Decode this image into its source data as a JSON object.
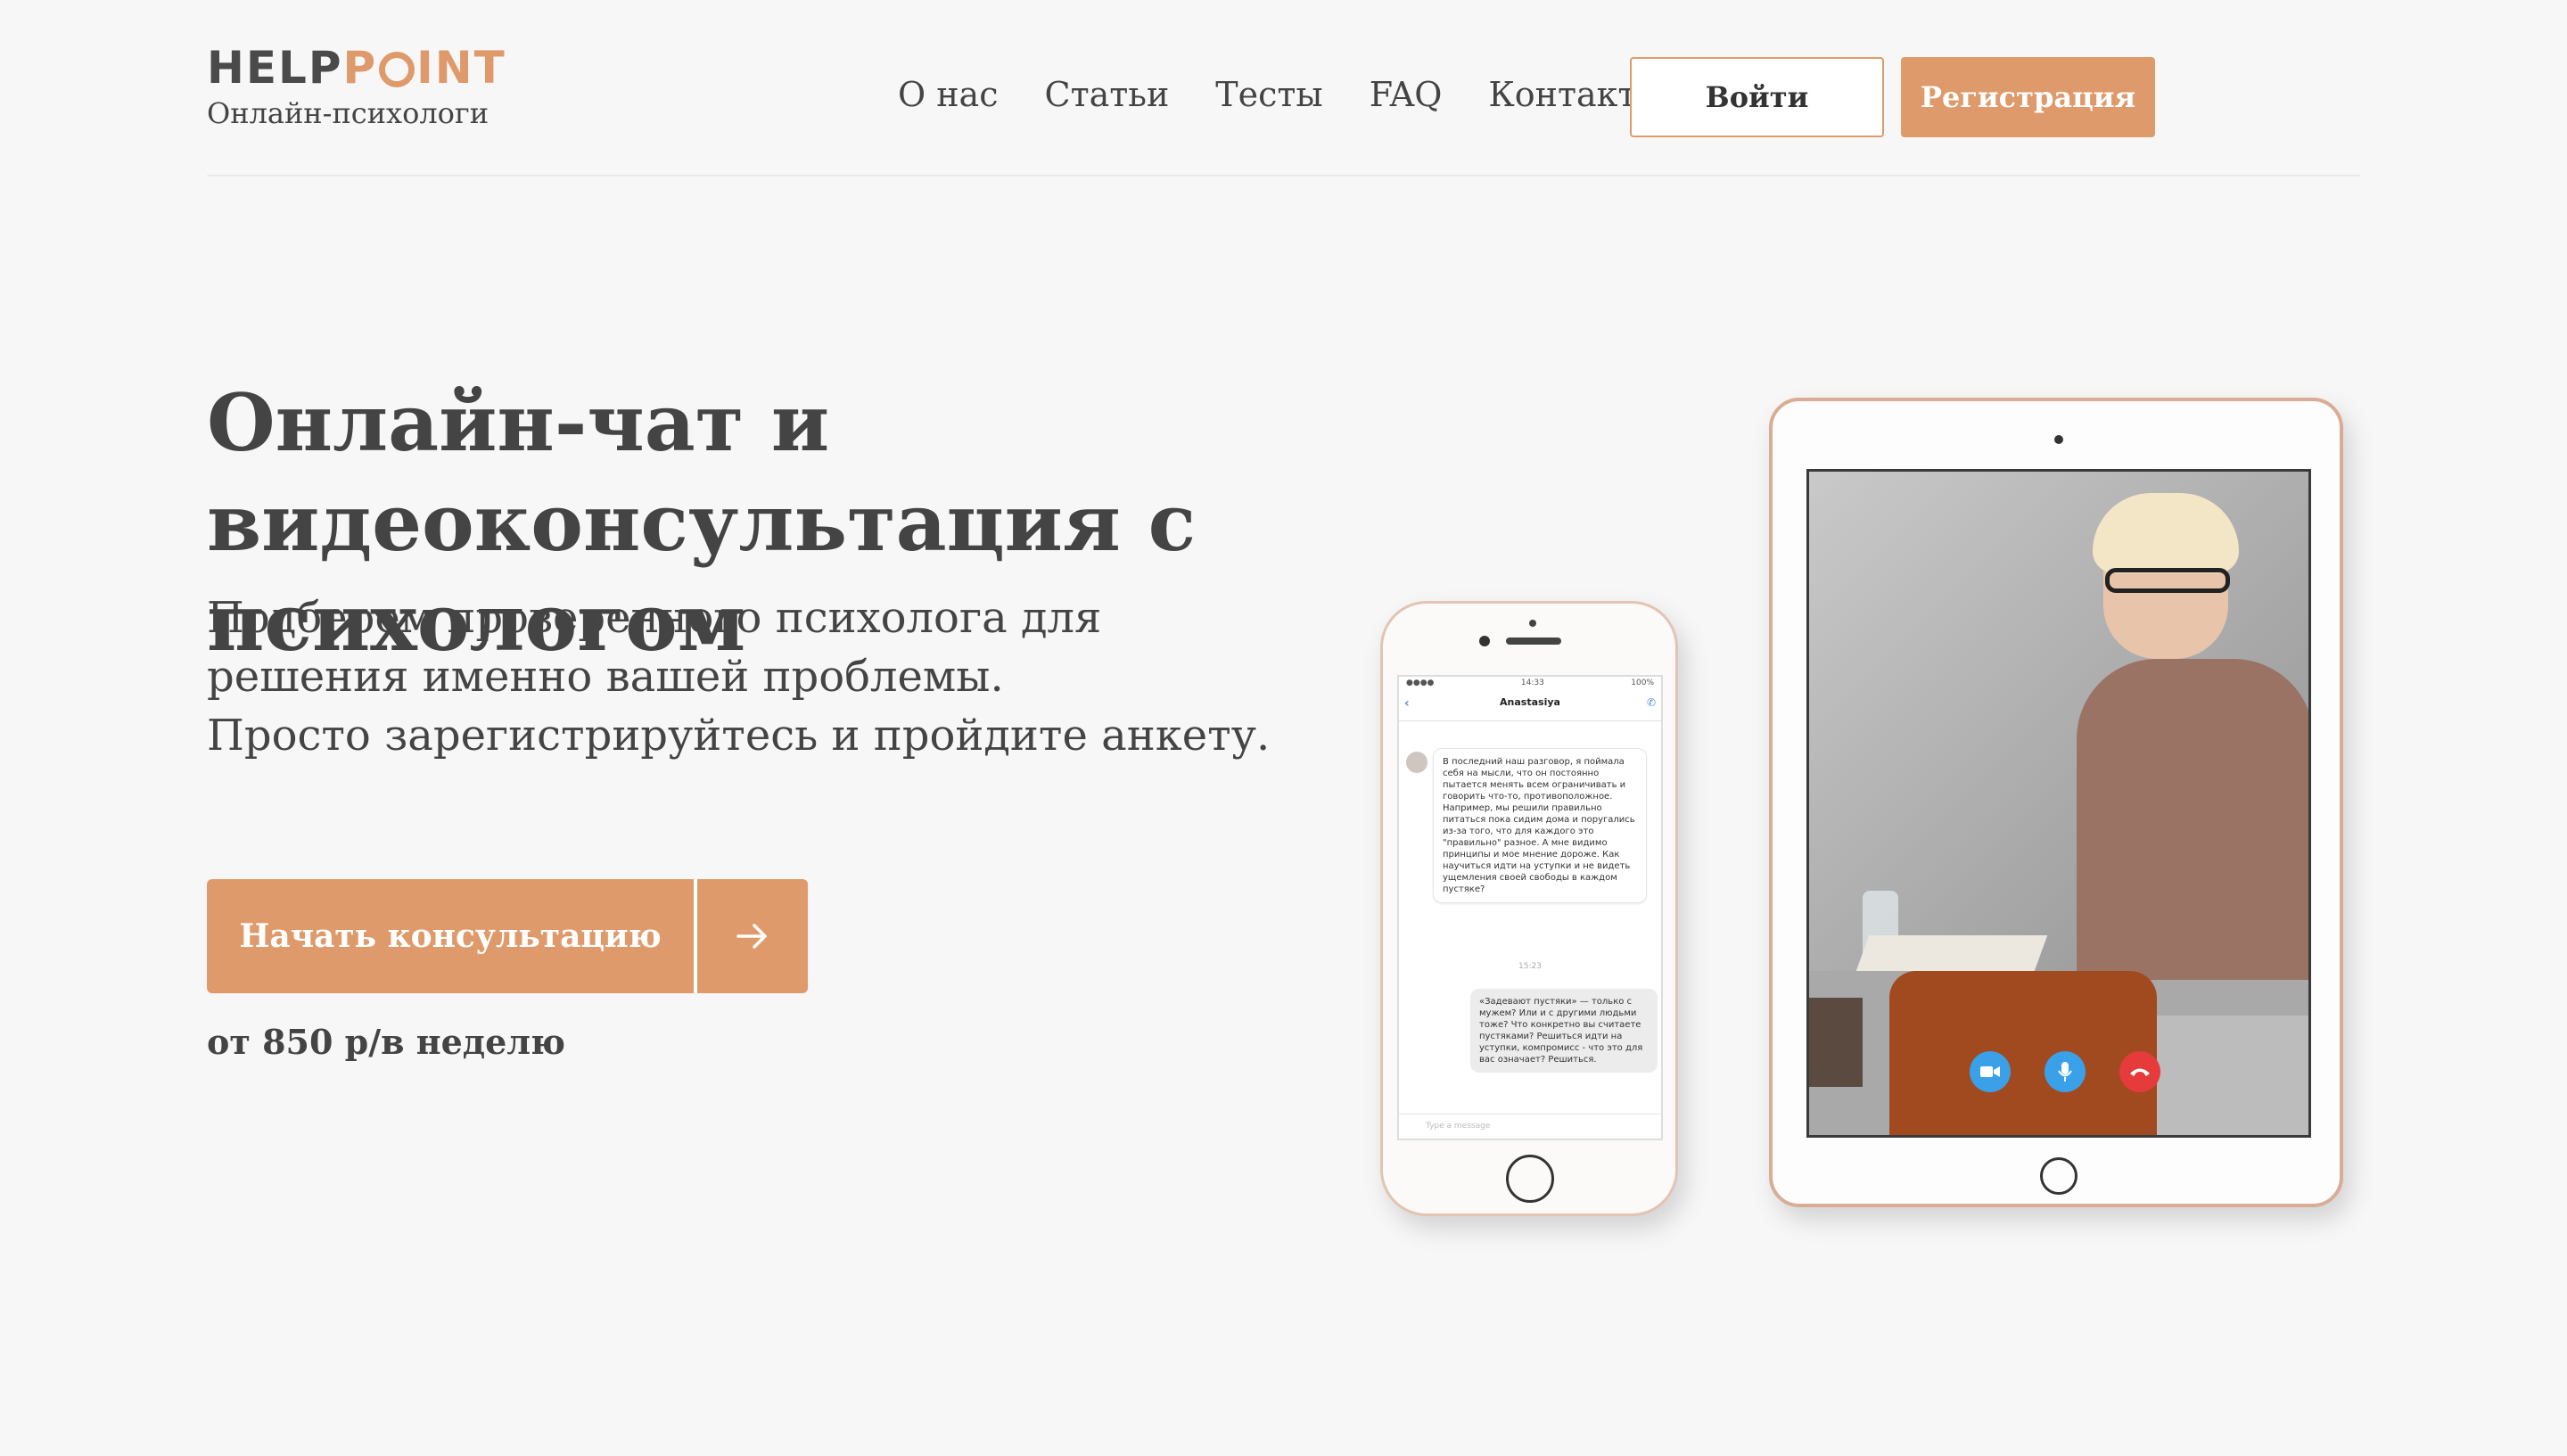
{
  "brand": {
    "logo_help": "HELP",
    "logo_p": "P",
    "logo_int": "INT",
    "tagline": "Онлайн-психологи",
    "accent_color": "#df9a6b"
  },
  "nav": {
    "items": [
      "О нас",
      "Статьи",
      "Тесты",
      "FAQ",
      "Контакты"
    ]
  },
  "auth": {
    "login_label": "Войти",
    "register_label": "Регистрация"
  },
  "hero": {
    "title_line1": "Онлайн-чат и",
    "title_line2": "видеоконсультация с психологом",
    "subtitle_line1": "Подберем проверенного психолога для",
    "subtitle_line2": "решения именно вашей проблемы.",
    "subtitle_line3": "Просто зарегистрируйтесь и пройдите анкету.",
    "cta_label": "Начать консультацию",
    "price": "от 850 р/в неделю"
  },
  "phone": {
    "time": "14:33",
    "battery": "100%",
    "contact": "Anastasiya",
    "message_in": "В последний наш разговор, я поймала себя на мысли, что он постоянно пытается менять всем ограничивать и говорить что-то, противоположное. Например, мы решили правильно питаться пока сидим дома и поругались из-за того, что для каждого это \"правильно\" разное. А мне видимо принципы и мое мнение дороже. Как научиться идти на уступки и не видеть ущемления своей свободы в каждом пустяке?",
    "message_time": "15:23",
    "message_out": "«Задевают пустяки» — только с мужем? Или и с другими людьми тоже? Что конкретно вы считаете пустяками? Решиться идти на уступки, компромисс - что это для вас означает? Решиться.",
    "input_placeholder": "Type a message"
  }
}
